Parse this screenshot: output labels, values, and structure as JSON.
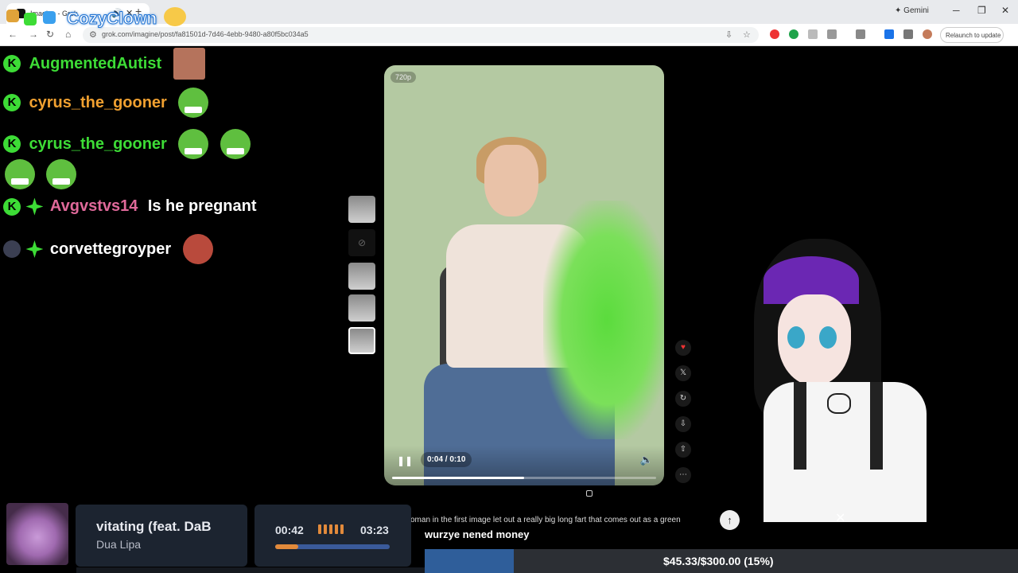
{
  "browser": {
    "tab_title": "Imagine - Grok",
    "url": "grok.com/imagine/post/fa81501d-7d46-4ebb-9480-a80f5bc034a5",
    "gemini_label": "Gemini",
    "relaunch_label": "Relaunch to update"
  },
  "overlay": {
    "title": "CozyClown"
  },
  "chat": [
    {
      "user": "AugmentedAutist",
      "color": "#3ddc36",
      "text": "",
      "emotes": [
        "face-emote"
      ],
      "star": false
    },
    {
      "user": "cyrus_the_gooner",
      "color": "#f0a030",
      "text": "",
      "emotes": [
        "pepe-emote"
      ],
      "star": false
    },
    {
      "user": "cyrus_the_gooner",
      "color": "#3ddc36",
      "text": "",
      "emotes": [
        "pepe-emote",
        "pepe-emote",
        "pepe-emote",
        "pepe-emote"
      ],
      "star": false
    },
    {
      "user": "Avgvstvs14",
      "color": "#e0699a",
      "text": "Is he pregnant",
      "emotes": [],
      "star": true
    },
    {
      "user": "corvettegroyper",
      "color": "#ffffff",
      "text": "",
      "emotes": [
        "face-emote"
      ],
      "star": true
    }
  ],
  "video": {
    "resolution": "720p",
    "current_time": "0:04",
    "duration": "0:10",
    "progress": 0.5
  },
  "prompt": {
    "text": "oman in the first image let out a really big long fart that comes out as a green"
  },
  "caption": "wurzye nened money",
  "music": {
    "title": "vitating (feat. DaB",
    "artist": "Dua Lipa",
    "current": "00:42",
    "duration": "03:23",
    "progress": 0.2
  },
  "goal": {
    "text": "$45.33/$300.00 (15%)",
    "progress": 0.15
  }
}
